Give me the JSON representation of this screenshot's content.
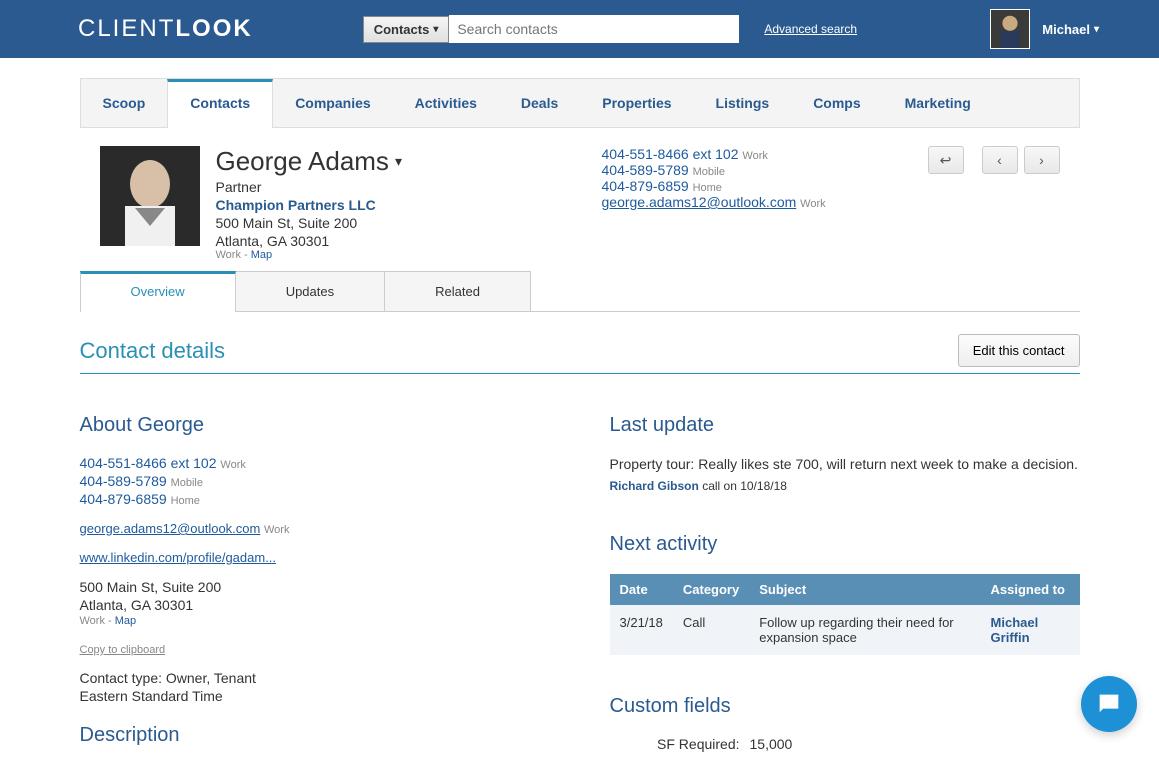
{
  "header": {
    "logo_light": "CLIENT",
    "logo_bold": "LOOK",
    "search_scope": "Contacts",
    "search_placeholder": "Search contacts",
    "advanced": "Advanced search",
    "username": "Michael"
  },
  "nav": [
    "Scoop",
    "Contacts",
    "Companies",
    "Activities",
    "Deals",
    "Properties",
    "Listings",
    "Comps",
    "Marketing"
  ],
  "nav_active": 1,
  "contact": {
    "name": "George Adams",
    "title": "Partner",
    "company": "Champion Partners LLC",
    "addr1": "500 Main St, Suite 200",
    "addr2": "Atlanta, GA 30301",
    "addr_type": "Work",
    "map": "Map",
    "phones": [
      {
        "num": "404-551-8466 ext 102",
        "type": "Work"
      },
      {
        "num": "404-589-5789",
        "type": "Mobile"
      },
      {
        "num": "404-879-6859",
        "type": "Home"
      }
    ],
    "email": "george.adams12@outlook.com",
    "email_type": "Work"
  },
  "sub_tabs": [
    "Overview",
    "Updates",
    "Related"
  ],
  "sub_active": 0,
  "details": {
    "title": "Contact details",
    "edit": "Edit this contact"
  },
  "about": {
    "heading": "About George",
    "phones": [
      {
        "num": "404-551-8466 ext 102",
        "type": "Work"
      },
      {
        "num": "404-589-5789",
        "type": "Mobile"
      },
      {
        "num": "404-879-6859",
        "type": "Home"
      }
    ],
    "email": "george.adams12@outlook.com",
    "email_type": "Work",
    "linkedin": "www.linkedin.com/profile/gadam...",
    "addr1": "500 Main St, Suite 200",
    "addr2": "Atlanta, GA 30301",
    "addr_type": "Work",
    "map": "Map",
    "copy": "Copy to clipboard",
    "contact_type": "Contact type: Owner, Tenant",
    "tz": "Eastern Standard Time"
  },
  "description_h": "Description",
  "last_update": {
    "heading": "Last update",
    "text": "Property tour: Really likes ste 700, will return next week to make a decision.",
    "who": "Richard Gibson",
    "meta": "call on 10/18/18"
  },
  "next": {
    "heading": "Next activity",
    "cols": [
      "Date",
      "Category",
      "Subject",
      "Assigned to"
    ],
    "row": {
      "date": "3/21/18",
      "category": "Call",
      "subject": "Follow up regarding their need for expansion space",
      "assigned": "Michael Griffin"
    }
  },
  "custom": {
    "heading": "Custom fields",
    "sf_label": "SF Required:",
    "sf_value": "15,000"
  }
}
